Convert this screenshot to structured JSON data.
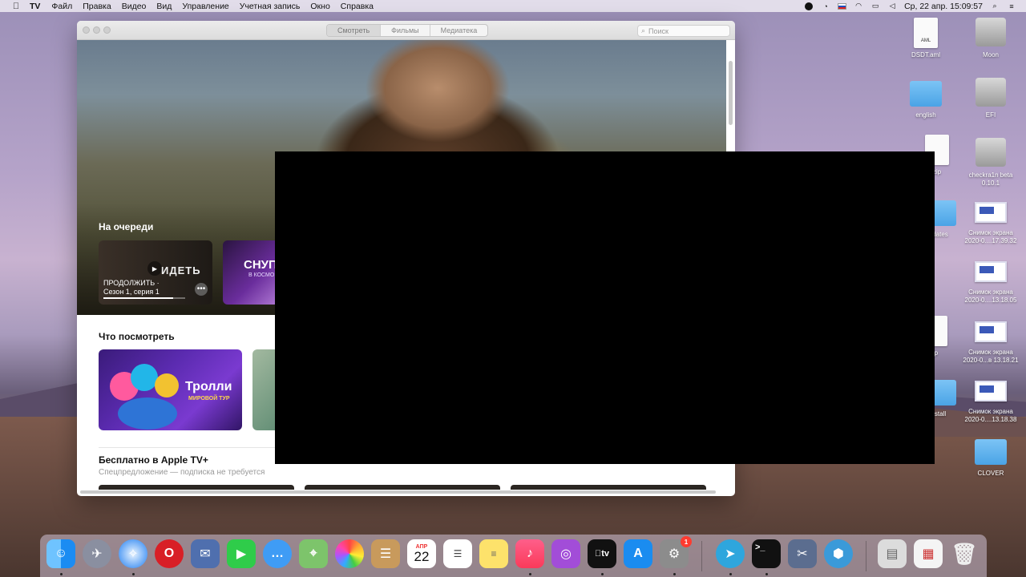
{
  "menubar": {
    "app_name": "TV",
    "items": [
      "Файл",
      "Правка",
      "Видео",
      "Вид",
      "Управление",
      "Учетная запись",
      "Окно",
      "Справка"
    ],
    "datetime": "Ср, 22 апр. 15:09:57"
  },
  "tv": {
    "tabs": [
      "Смотреть",
      "Фильмы",
      "Медиатека"
    ],
    "search_placeholder": "Поиск",
    "up_next_title": "На очереди",
    "card1_word": "ИДЕТЬ",
    "card1_label": "ПРОДОЛЖИТЬ ·",
    "card1_episode": "Сезон 1, серия 1",
    "card1_progress": 0.85,
    "card2_word": "СНУП",
    "card2_sub": "В КОСМО",
    "watch_title": "Что посмотреть",
    "trolls_title": "Тролли",
    "trolls_sub": "МИРОВОЙ ТУР",
    "free_title": "Бесплатно в Apple TV+",
    "free_subtitle": "Спецпредложение — подписка не требуется"
  },
  "desktop": {
    "icons": [
      {
        "label": "DSDT.aml",
        "file_tag": "AML"
      },
      {
        "label": "Moon"
      },
      {
        "label": "english"
      },
      {
        "label": "EFI"
      },
      {
        "label": "zip"
      },
      {
        "label": "checkra1n beta 0.10.1"
      },
      {
        "label": "dates"
      },
      {
        "label": "Снимок экрана 2020-0....17.39.32"
      },
      {
        "label": "Снимок экрана 2020-0....13.18.05"
      },
      {
        "label": "ip"
      },
      {
        "label": "Снимок экрана 2020-0...в 13.18.21"
      },
      {
        "label": "stall"
      },
      {
        "label": "Снимок экрана 2020-0....13.18.38"
      },
      {
        "label": "CLOVER"
      }
    ]
  },
  "dock": {
    "calendar_month": "АПР",
    "calendar_day": "22",
    "tv_label": "tv",
    "prefs_badge": "1"
  }
}
